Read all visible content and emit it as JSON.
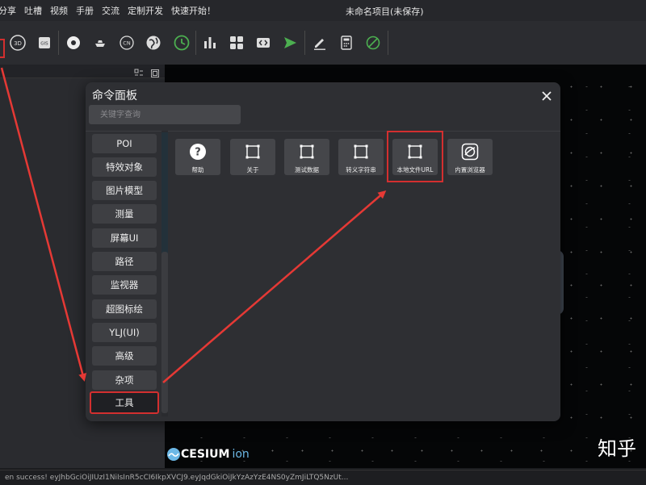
{
  "menu": {
    "items": [
      "分享",
      "吐槽",
      "视频",
      "手册",
      "交流",
      "定制开发",
      "快速开始！"
    ]
  },
  "window": {
    "title": "未命名项目(未保存)"
  },
  "toolbar": {
    "icons": [
      "3d-icon",
      "gis-icon",
      "disc-icon",
      "boat-icon",
      "cn-icon",
      "globe-icon",
      "clock-icon",
      "bar-chart-icon",
      "widgets-icon",
      "code-icon",
      "play-icon",
      "pen-icon",
      "calculator-icon",
      "forbidden-icon"
    ],
    "accent_color": "#4caf50"
  },
  "modal": {
    "title": "命令面板",
    "search_placeholder": "关键字查询",
    "categories": [
      "POI",
      "特效对象",
      "图片模型",
      "测量",
      "屏幕UI",
      "路径",
      "监视器",
      "超图标绘",
      "YLJ(UI)",
      "高级",
      "杂项",
      "工具"
    ],
    "selected_category": "工具",
    "tools": [
      {
        "label": "帮助",
        "icon": "help-icon"
      },
      {
        "label": "关于",
        "icon": "frame-icon"
      },
      {
        "label": "测试数据",
        "icon": "frame-icon"
      },
      {
        "label": "转义字符串",
        "icon": "frame-icon"
      },
      {
        "label": "本地文件URL",
        "icon": "frame-icon"
      },
      {
        "label": "内置浏览器",
        "icon": "browser-icon"
      }
    ],
    "highlight_color": "#d32f2f"
  },
  "viewport": {
    "logo_text": "CESIUM",
    "logo_suffix": "ion",
    "watermark": "知乎"
  },
  "status": {
    "text": "en success! eyJhbGciOiJIUzI1NiIsInR5cCI6IkpXVCJ9.eyJqdGkiOiJkYzAzYzE4NS0yZmJiLTQ5NzUt..."
  }
}
